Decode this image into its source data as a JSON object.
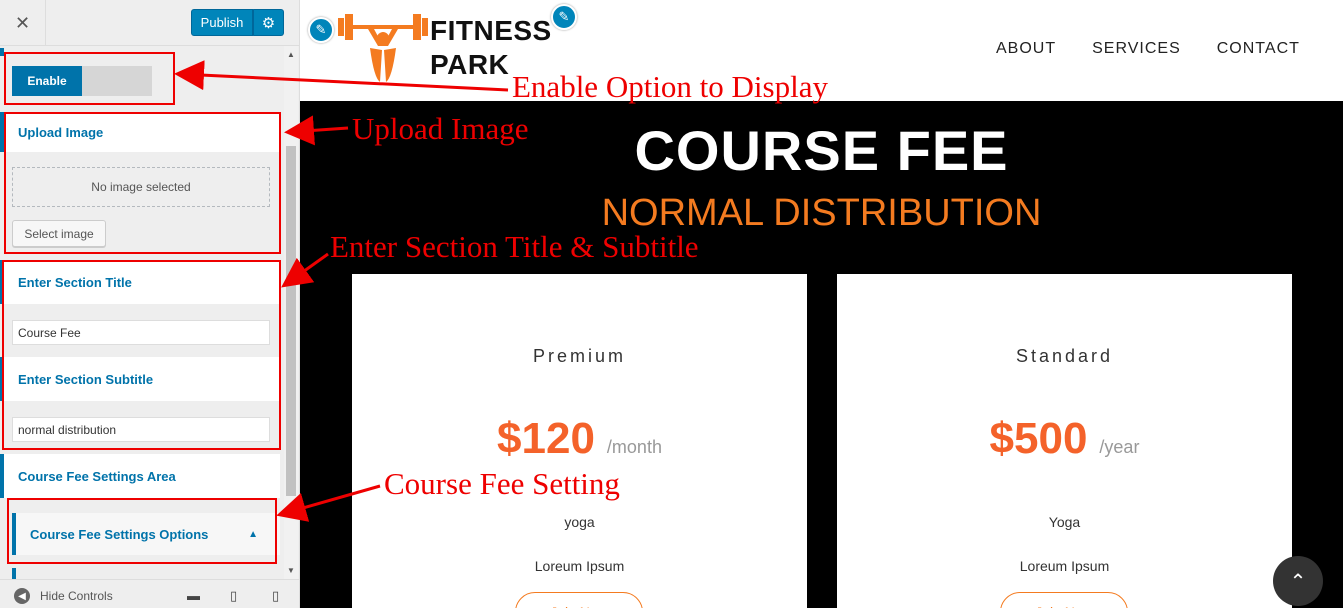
{
  "sidebar": {
    "close_glyph": "✕",
    "publish_label": "Publish",
    "enable_label": "Enable",
    "upload_image_label": "Upload Image",
    "no_image_text": "No image selected",
    "select_image_label": "Select image",
    "section_title_label": "Enter Section Title",
    "section_title_value": "Course Fee",
    "section_subtitle_label": "Enter Section Subtitle",
    "section_subtitle_value": "normal distribution",
    "settings_area_label": "Course Fee Settings Area",
    "settings_options_label": "Course Fee Settings Options",
    "hide_controls_label": "Hide Controls"
  },
  "header": {
    "logo_line1": "FITNESS",
    "logo_line2": "PARK",
    "nav": [
      "ABOUT",
      "SERVICES",
      "CONTACT"
    ]
  },
  "section": {
    "title": "COURSE FEE",
    "subtitle": "NORMAL DISTRIBUTION"
  },
  "cards": [
    {
      "name": "Premium",
      "price": "$120",
      "period": "/month",
      "feature1": "yoga",
      "feature2": "Loreum Ipsum",
      "button": "Join Now"
    },
    {
      "name": "Standard",
      "price": "$500",
      "period": "/year",
      "feature1": "Yoga",
      "feature2": "Loreum Ipsum",
      "button": "Join Now"
    }
  ],
  "annotations": {
    "enable": "Enable Option to Display",
    "upload": "Upload Image",
    "title": "Enter Section Title & Subtitle",
    "setting": "Course Fee Setting"
  },
  "colors": {
    "wp_blue": "#0073aa",
    "accent_orange": "#f47b20",
    "price_orange": "#f4622a",
    "annotation_red": "#ee0000"
  },
  "icons": [
    "close-icon",
    "gear-icon",
    "pencil-icon",
    "chevron-up-icon",
    "desktop-icon",
    "tablet-icon",
    "mobile-icon",
    "scroll-top-icon"
  ]
}
